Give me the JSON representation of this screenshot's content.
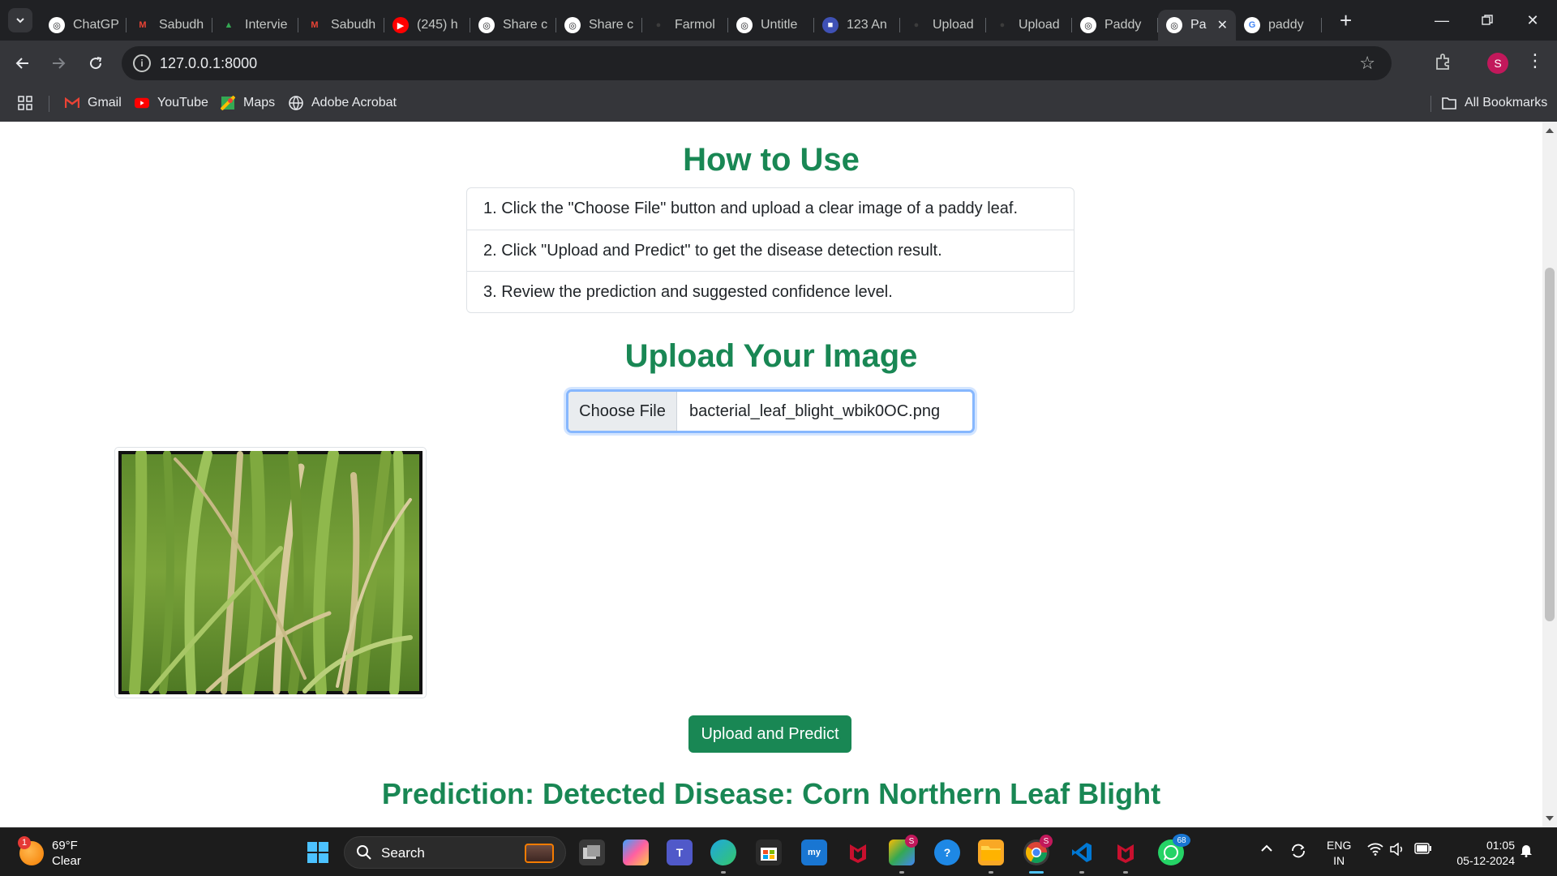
{
  "browser": {
    "tabs": [
      {
        "title": "ChatGP",
        "icon": "chatgpt-icon"
      },
      {
        "title": "Sabudh",
        "icon": "gmail-icon"
      },
      {
        "title": "Intervie",
        "icon": "google-drive-icon"
      },
      {
        "title": "Sabudh",
        "icon": "gmail-icon"
      },
      {
        "title": "(245) h",
        "icon": "youtube-icon"
      },
      {
        "title": "Share c",
        "icon": "chatgpt-icon"
      },
      {
        "title": "Share c",
        "icon": "chatgpt-icon"
      },
      {
        "title": "Farmol",
        "icon": "github-icon"
      },
      {
        "title": "Untitle",
        "icon": "chatgpt-icon"
      },
      {
        "title": "123 An",
        "icon": "app-icon"
      },
      {
        "title": "Upload",
        "icon": "github-icon"
      },
      {
        "title": "Upload",
        "icon": "github-icon"
      },
      {
        "title": "Paddy",
        "icon": "chatgpt-icon"
      },
      {
        "title": "Pa",
        "icon": "chatgpt-icon",
        "active": true
      },
      {
        "title": "paddy",
        "icon": "google-icon"
      }
    ],
    "url": "127.0.0.1:8000",
    "profile_initial": "S",
    "bookmarks": [
      {
        "label": "Gmail",
        "icon": "gmail-icon"
      },
      {
        "label": "YouTube",
        "icon": "youtube-icon"
      },
      {
        "label": "Maps",
        "icon": "maps-icon"
      },
      {
        "label": "Adobe Acrobat",
        "icon": "globe-icon"
      }
    ],
    "all_bookmarks": "All Bookmarks"
  },
  "page": {
    "how_to_title": "How to Use",
    "steps": [
      "1. Click the \"Choose File\" button and upload a clear image of a paddy leaf.",
      "2. Click \"Upload and Predict\" to get the disease detection result.",
      "3. Review the prediction and suggested confidence level."
    ],
    "upload_title": "Upload Your Image",
    "choose_file": "Choose File",
    "file_name": "bacterial_leaf_blight_wbik0OC.png",
    "predict_button": "Upload and Predict",
    "prediction": "Prediction: Detected Disease: Corn Northern Leaf Blight",
    "colors": {
      "primary": "#198754"
    }
  },
  "taskbar": {
    "weather_temp": "69°F",
    "weather_desc": "Clear",
    "weather_badge": "1",
    "search_label": "Search",
    "language": "ENG",
    "region": "IN",
    "time": "01:05",
    "date": "05-12-2024",
    "chrome_badge": "S",
    "whatsapp_badge": "68",
    "colab_badge": "S"
  }
}
